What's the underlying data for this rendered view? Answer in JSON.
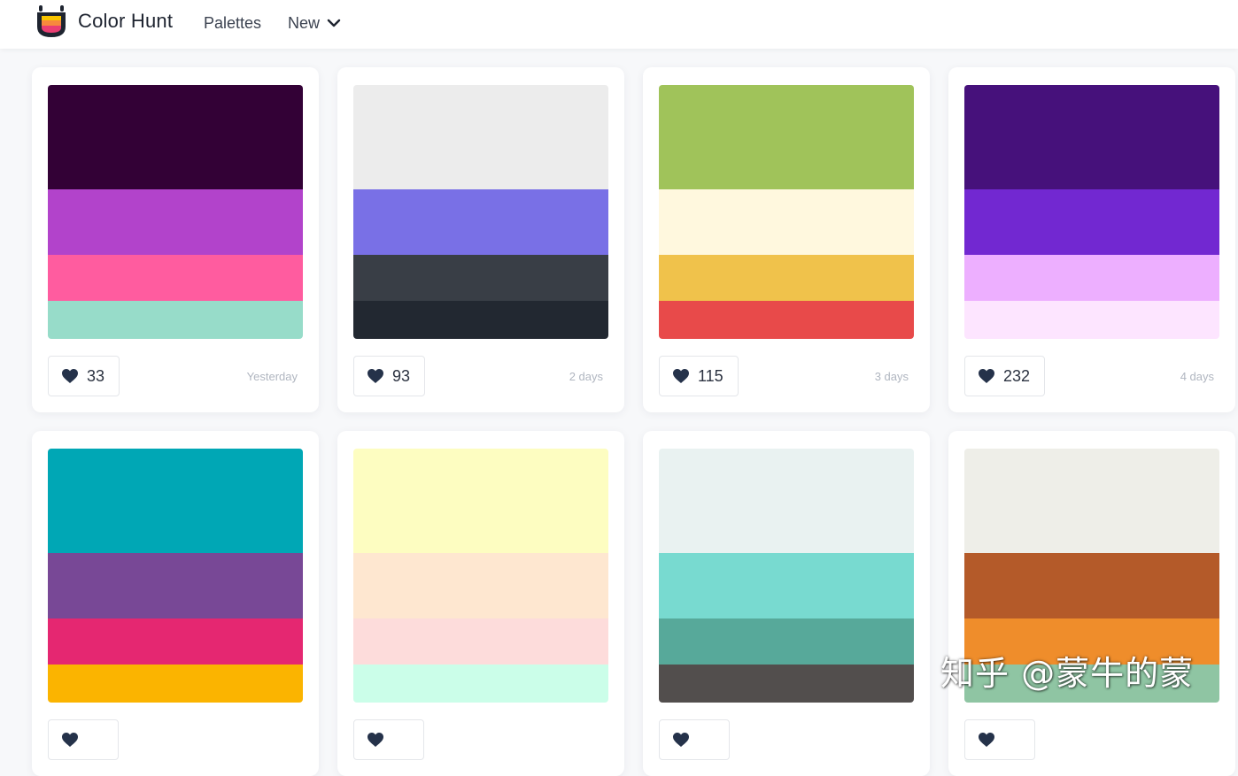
{
  "header": {
    "brand": "Color Hunt",
    "nav": {
      "palettes": "Palettes",
      "new": "New"
    },
    "logo_colors": [
      "#f8c400",
      "#f7893d",
      "#ea3e73",
      "#1e2430"
    ]
  },
  "palettes": [
    {
      "colors": [
        "#330136",
        "#b243cb",
        "#ff5c9f",
        "#97dcc9"
      ],
      "likes": "33",
      "date": "Yesterday"
    },
    {
      "colors": [
        "#ececec",
        "#7970e6",
        "#393e46",
        "#222831"
      ],
      "likes": "93",
      "date": "2 days"
    },
    {
      "colors": [
        "#a0c35a",
        "#fff8de",
        "#f0c24b",
        "#e84a4a"
      ],
      "likes": "115",
      "date": "3 days"
    },
    {
      "colors": [
        "#46117b",
        "#7228d1",
        "#edafff",
        "#fde5ff"
      ],
      "likes": "232",
      "date": "4 days"
    },
    {
      "colors": [
        "#00a7b5",
        "#784896",
        "#e52771",
        "#fbb400"
      ],
      "likes": "",
      "date": ""
    },
    {
      "colors": [
        "#fdfdc1",
        "#fee7d0",
        "#fddcdb",
        "#cbfee9"
      ],
      "likes": "",
      "date": ""
    },
    {
      "colors": [
        "#e9f2f1",
        "#78dad0",
        "#57a99a",
        "#524e4d"
      ],
      "likes": "",
      "date": ""
    },
    {
      "colors": [
        "#eeeee8",
        "#b45a29",
        "#ef8d2b",
        "#8fc5a3"
      ],
      "likes": "",
      "date": ""
    }
  ],
  "watermark": "知乎 @蒙牛的蒙"
}
